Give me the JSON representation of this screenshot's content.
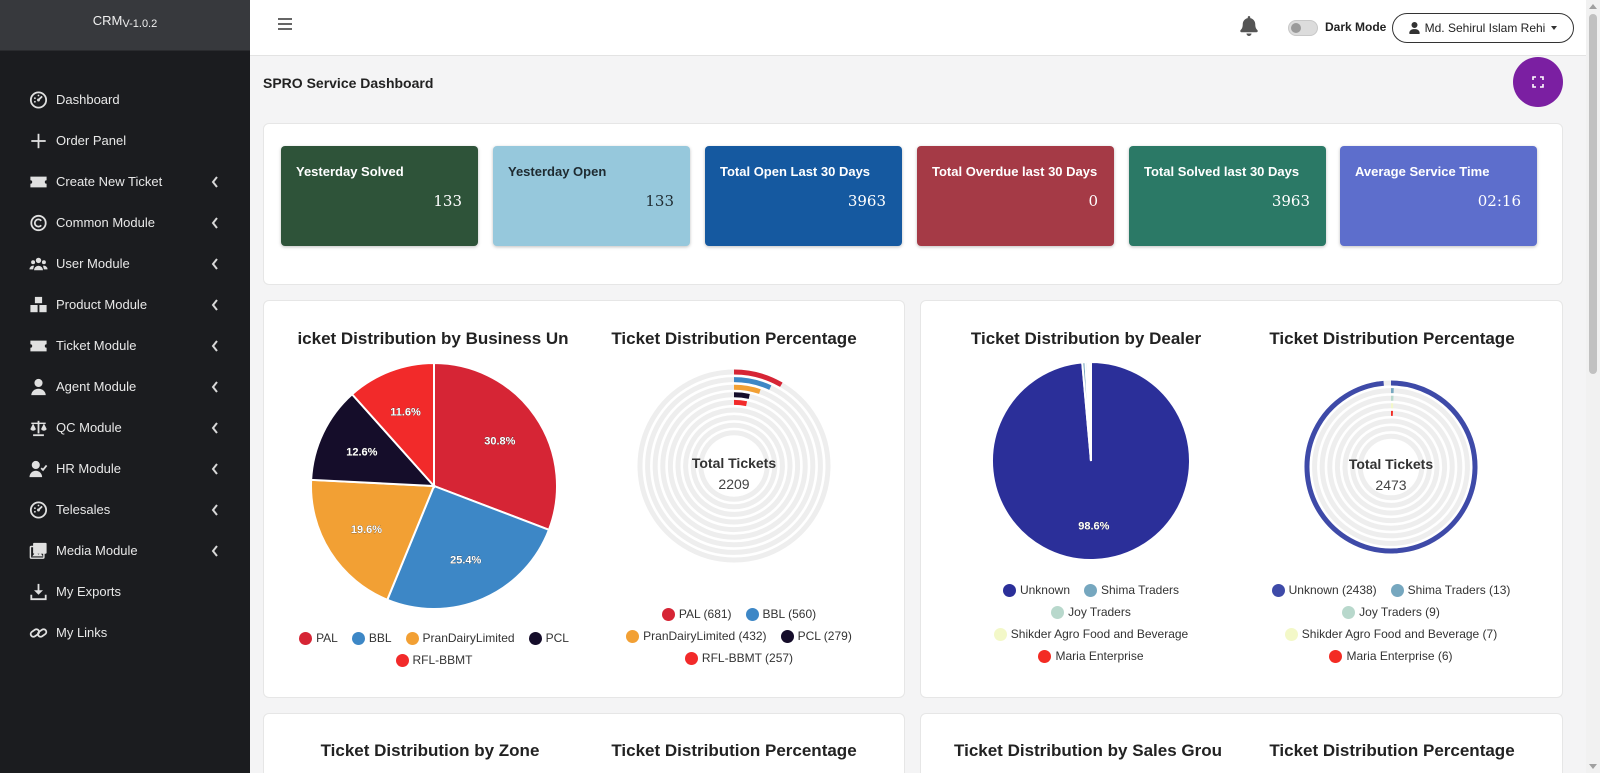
{
  "app": {
    "brand": "CRM",
    "version": "V-1.0.2"
  },
  "sidebar": {
    "items": [
      {
        "label": "Dashboard",
        "icon": "dashboard-gauge-icon",
        "has_submenu": false
      },
      {
        "label": "Order Panel",
        "icon": "plus-icon",
        "has_submenu": false
      },
      {
        "label": "Create New Ticket",
        "icon": "ticket-icon",
        "has_submenu": true
      },
      {
        "label": "Common Module",
        "icon": "copyright-icon",
        "has_submenu": true
      },
      {
        "label": "User Module",
        "icon": "users-icon",
        "has_submenu": true
      },
      {
        "label": "Product Module",
        "icon": "boxes-icon",
        "has_submenu": true
      },
      {
        "label": "Ticket Module",
        "icon": "ticket-icon",
        "has_submenu": true
      },
      {
        "label": "Agent Module",
        "icon": "user-icon",
        "has_submenu": true
      },
      {
        "label": "QC Module",
        "icon": "balance-scale-icon",
        "has_submenu": true
      },
      {
        "label": "HR Module",
        "icon": "user-check-icon",
        "has_submenu": true
      },
      {
        "label": "Telesales",
        "icon": "dashboard-gauge-icon",
        "has_submenu": true
      },
      {
        "label": "Media Module",
        "icon": "images-icon",
        "has_submenu": true
      },
      {
        "label": "My Exports",
        "icon": "download-icon",
        "has_submenu": false
      },
      {
        "label": "My Links",
        "icon": "link-icon",
        "has_submenu": false
      }
    ]
  },
  "topbar": {
    "dark_mode_label": "Dark Mode",
    "user_name": "Md. Sehirul Islam Rehi"
  },
  "page": {
    "title": "SPRO Service Dashboard"
  },
  "stats": [
    {
      "title": "Yesterday Solved",
      "value": "133",
      "bg": "#2e5339",
      "fg": "#ffffff"
    },
    {
      "title": "Yesterday Open",
      "value": "133",
      "bg": "#96c8dc",
      "fg": "#1e2a30"
    },
    {
      "title": "Total Open Last 30 Days",
      "value": "3963",
      "bg": "#1559a0",
      "fg": "#ffffff"
    },
    {
      "title": "Total Overdue last 30 Days",
      "value": "0",
      "bg": "#a53a46",
      "fg": "#ffffff"
    },
    {
      "title": "Total Solved last 30 Days",
      "value": "3963",
      "bg": "#2b7966",
      "fg": "#ffffff"
    },
    {
      "title": "Average Service Time",
      "value": "02:16",
      "bg": "#5d6ecc",
      "fg": "#ffffff"
    }
  ],
  "chart_data": [
    {
      "type": "pie",
      "title": "Ticket Distribution by Business Unit",
      "title_visible": "icket Distribution by Business Un",
      "categories": [
        "PAL",
        "BBL",
        "PranDairyLimited",
        "PCL",
        "RFL-BBMT"
      ],
      "values": [
        30.8,
        25.4,
        19.6,
        12.6,
        11.6
      ],
      "data_labels": [
        "30.8%",
        "25.4%",
        "19.6%",
        "12.6%",
        "11.6%"
      ],
      "colors": [
        "#d62535",
        "#3d87c6",
        "#f2a034",
        "#150d2a",
        "#f22a2a"
      ],
      "legend": [
        "PAL",
        "BBL",
        "PranDairyLimited",
        "PCL",
        "RFL-BBMT"
      ]
    },
    {
      "type": "radialBar",
      "title": "Ticket Distribution Percentage",
      "center_label": "Total Tickets",
      "center_value": "2209",
      "categories": [
        "PAL",
        "BBL",
        "PranDairyLimited",
        "PCL",
        "RFL-BBMT"
      ],
      "values": [
        681,
        560,
        432,
        279,
        257
      ],
      "colors": [
        "#d62535",
        "#3d87c6",
        "#f2a034",
        "#150d2a",
        "#f22a2a"
      ],
      "legend": [
        "PAL (681)",
        "BBL (560)",
        "PranDairyLimited (432)",
        "PCL (279)",
        "RFL-BBMT (257)"
      ]
    },
    {
      "type": "pie",
      "title": "Ticket Distribution by Dealer",
      "categories": [
        "Unknown",
        "Shima Traders",
        "Joy Traders",
        "Shikder Agro Food and Beverage",
        "Maria Enterprise"
      ],
      "values": [
        2438,
        13,
        9,
        7,
        6
      ],
      "data_labels": [
        "98.6%"
      ],
      "colors": [
        "#2b2f99",
        "#76a7bf",
        "#b8d8cc",
        "#f3f8c8",
        "#f32b23"
      ],
      "legend": [
        "Unknown",
        "Shima Traders",
        "Joy Traders",
        "Shikder Agro Food and Beverage",
        "Maria Enterprise"
      ]
    },
    {
      "type": "radialBar",
      "title": "Ticket Distribution Percentage",
      "center_label": "Total Tickets",
      "center_value": "2473",
      "categories": [
        "Unknown",
        "Shima Traders",
        "Joy Traders",
        "Shikder Agro Food and Beverage",
        "Maria Enterprise"
      ],
      "values": [
        2438,
        13,
        9,
        7,
        6
      ],
      "colors": [
        "#3e4aa8",
        "#76a7bf",
        "#b8d8cc",
        "#f3f8c8",
        "#f32b23"
      ],
      "legend": [
        "Unknown (2438)",
        "Shima Traders (13)",
        "Joy Traders (9)",
        "Shikder Agro Food and Beverage (7)",
        "Maria Enterprise (6)"
      ]
    }
  ],
  "lower_titles": {
    "zone": "Ticket Distribution by Zone",
    "zone_pct": "Ticket Distribution Percentage",
    "sales_group": "Ticket Distribution by Sales Group",
    "sales_group_visible": "Ticket Distribution by Sales Grou",
    "sales_group_pct": "Ticket Distribution Percentage"
  }
}
